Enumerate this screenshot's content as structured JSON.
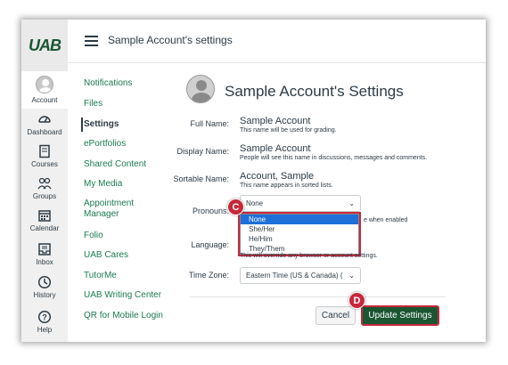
{
  "brand": {
    "logo_text": "UAB",
    "accent": "#1a5632",
    "annotation_red": "#c8283b",
    "link_green": "#1a7a52"
  },
  "global_nav": [
    {
      "label": "Account",
      "icon": "account-avatar-icon"
    },
    {
      "label": "Dashboard",
      "icon": "dashboard-icon"
    },
    {
      "label": "Courses",
      "icon": "courses-icon"
    },
    {
      "label": "Groups",
      "icon": "groups-icon"
    },
    {
      "label": "Calendar",
      "icon": "calendar-icon"
    },
    {
      "label": "Inbox",
      "icon": "inbox-icon"
    },
    {
      "label": "History",
      "icon": "history-icon"
    },
    {
      "label": "Help",
      "icon": "help-icon"
    }
  ],
  "header": {
    "breadcrumb": "Sample Account's settings"
  },
  "section_nav": [
    {
      "label": "Notifications"
    },
    {
      "label": "Files"
    },
    {
      "label": "Settings"
    },
    {
      "label": "ePortfolios"
    },
    {
      "label": "Shared Content"
    },
    {
      "label": "My Media"
    },
    {
      "label": "Appointment Manager"
    },
    {
      "label": "Folio"
    },
    {
      "label": "UAB Cares"
    },
    {
      "label": "TutorMe"
    },
    {
      "label": "UAB Writing Center"
    },
    {
      "label": "QR for Mobile Login"
    }
  ],
  "content": {
    "title": "Sample Account's Settings",
    "full_name_label": "Full Name:",
    "full_name": "Sample Account",
    "full_name_hint": "This name will be used for grading.",
    "display_name_label": "Display Name:",
    "display_name": "Sample Account",
    "display_name_hint": "People will see this name in discussions, messages and comments.",
    "sortable_name_label": "Sortable Name:",
    "sortable_name": "Account, Sample",
    "sortable_name_hint": "This name appears in sorted lists.",
    "pronouns_label": "Pronouns:",
    "pronouns_value": "None",
    "pronoun_options": [
      "None",
      "She/Her",
      "He/Him",
      "They/Them"
    ],
    "pronouns_side_text": "e when enabled",
    "language_label": "Language:",
    "language_hint": "This will override any browser or account settings.",
    "timezone_label": "Time Zone:",
    "timezone_value": "Eastern Time (US & Canada) (",
    "cancel_label": "Cancel",
    "update_label": "Update Settings"
  },
  "annotations": {
    "c": "C",
    "d": "D"
  }
}
